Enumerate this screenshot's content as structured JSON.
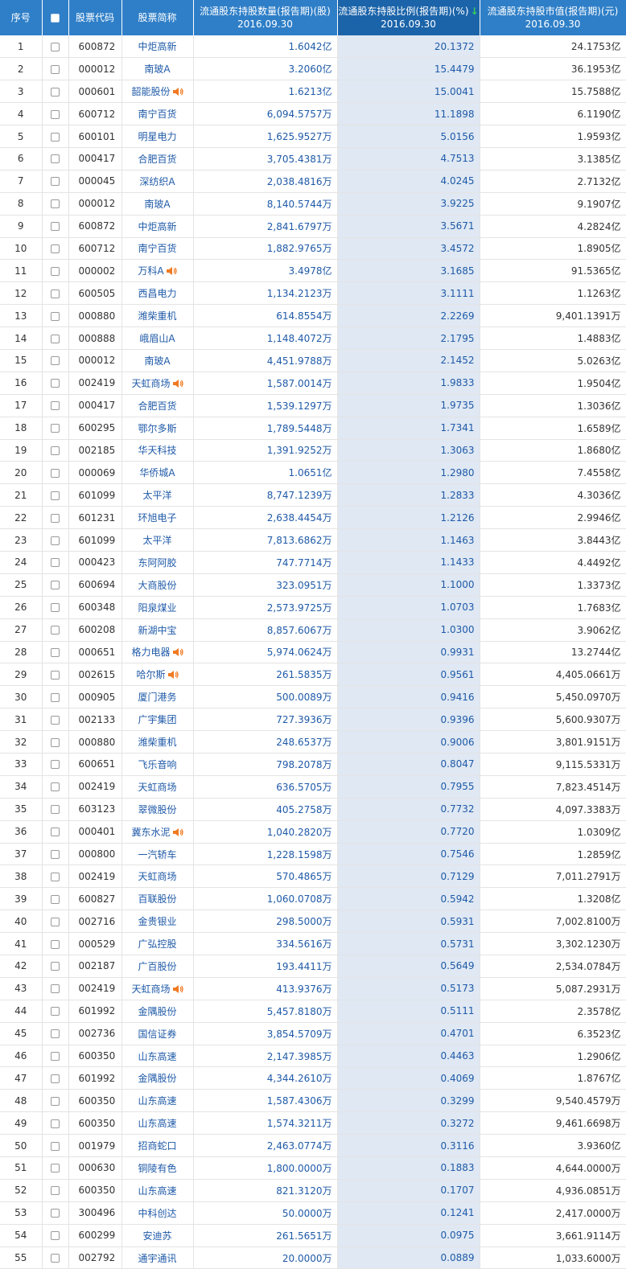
{
  "header": {
    "seq": "序号",
    "code": "股票代码",
    "name": "股票简称",
    "qty": "流通股东持股数量(报告期)(股)",
    "ratio": "流通股东持股比例(报告期)(%)",
    "ratio_arrow": "↓",
    "value": "流通股东持股市值(报告期)(元)",
    "period": "2016.09.30"
  },
  "colors": {
    "header_bg": "#2f7fc8",
    "sorted_col_bg": "#dfe8f3",
    "link": "#1f5aa8",
    "speaker": "#f07a22"
  },
  "rows": [
    {
      "seq": "1",
      "code": "600872",
      "name": "中炬高新",
      "qty": "1.6042亿",
      "ratio": "20.1372",
      "value": "24.1753亿",
      "speaker": false
    },
    {
      "seq": "2",
      "code": "000012",
      "name": "南玻A",
      "qty": "3.2060亿",
      "ratio": "15.4479",
      "value": "36.1953亿",
      "speaker": false
    },
    {
      "seq": "3",
      "code": "000601",
      "name": "韶能股份",
      "qty": "1.6213亿",
      "ratio": "15.0041",
      "value": "15.7588亿",
      "speaker": true
    },
    {
      "seq": "4",
      "code": "600712",
      "name": "南宁百货",
      "qty": "6,094.5757万",
      "ratio": "11.1898",
      "value": "6.1190亿",
      "speaker": false
    },
    {
      "seq": "5",
      "code": "600101",
      "name": "明星电力",
      "qty": "1,625.9527万",
      "ratio": "5.0156",
      "value": "1.9593亿",
      "speaker": false
    },
    {
      "seq": "6",
      "code": "000417",
      "name": "合肥百货",
      "qty": "3,705.4381万",
      "ratio": "4.7513",
      "value": "3.1385亿",
      "speaker": false
    },
    {
      "seq": "7",
      "code": "000045",
      "name": "深纺织A",
      "qty": "2,038.4816万",
      "ratio": "4.0245",
      "value": "2.7132亿",
      "speaker": false
    },
    {
      "seq": "8",
      "code": "000012",
      "name": "南玻A",
      "qty": "8,140.5744万",
      "ratio": "3.9225",
      "value": "9.1907亿",
      "speaker": false
    },
    {
      "seq": "9",
      "code": "600872",
      "name": "中炬高新",
      "qty": "2,841.6797万",
      "ratio": "3.5671",
      "value": "4.2824亿",
      "speaker": false
    },
    {
      "seq": "10",
      "code": "600712",
      "name": "南宁百货",
      "qty": "1,882.9765万",
      "ratio": "3.4572",
      "value": "1.8905亿",
      "speaker": false
    },
    {
      "seq": "11",
      "code": "000002",
      "name": "万科A",
      "qty": "3.4978亿",
      "ratio": "3.1685",
      "value": "91.5365亿",
      "speaker": true
    },
    {
      "seq": "12",
      "code": "600505",
      "name": "西昌电力",
      "qty": "1,134.2123万",
      "ratio": "3.1111",
      "value": "1.1263亿",
      "speaker": false
    },
    {
      "seq": "13",
      "code": "000880",
      "name": "潍柴重机",
      "qty": "614.8554万",
      "ratio": "2.2269",
      "value": "9,401.1391万",
      "speaker": false
    },
    {
      "seq": "14",
      "code": "000888",
      "name": "峨眉山A",
      "qty": "1,148.4072万",
      "ratio": "2.1795",
      "value": "1.4883亿",
      "speaker": false
    },
    {
      "seq": "15",
      "code": "000012",
      "name": "南玻A",
      "qty": "4,451.9788万",
      "ratio": "2.1452",
      "value": "5.0263亿",
      "speaker": false
    },
    {
      "seq": "16",
      "code": "002419",
      "name": "天虹商场",
      "qty": "1,587.0014万",
      "ratio": "1.9833",
      "value": "1.9504亿",
      "speaker": true
    },
    {
      "seq": "17",
      "code": "000417",
      "name": "合肥百货",
      "qty": "1,539.1297万",
      "ratio": "1.9735",
      "value": "1.3036亿",
      "speaker": false
    },
    {
      "seq": "18",
      "code": "600295",
      "name": "鄂尔多斯",
      "qty": "1,789.5448万",
      "ratio": "1.7341",
      "value": "1.6589亿",
      "speaker": false
    },
    {
      "seq": "19",
      "code": "002185",
      "name": "华天科技",
      "qty": "1,391.9252万",
      "ratio": "1.3063",
      "value": "1.8680亿",
      "speaker": false
    },
    {
      "seq": "20",
      "code": "000069",
      "name": "华侨城A",
      "qty": "1.0651亿",
      "ratio": "1.2980",
      "value": "7.4558亿",
      "speaker": false
    },
    {
      "seq": "21",
      "code": "601099",
      "name": "太平洋",
      "qty": "8,747.1239万",
      "ratio": "1.2833",
      "value": "4.3036亿",
      "speaker": false
    },
    {
      "seq": "22",
      "code": "601231",
      "name": "环旭电子",
      "qty": "2,638.4454万",
      "ratio": "1.2126",
      "value": "2.9946亿",
      "speaker": false
    },
    {
      "seq": "23",
      "code": "601099",
      "name": "太平洋",
      "qty": "7,813.6862万",
      "ratio": "1.1463",
      "value": "3.8443亿",
      "speaker": false
    },
    {
      "seq": "24",
      "code": "000423",
      "name": "东阿阿胶",
      "qty": "747.7714万",
      "ratio": "1.1433",
      "value": "4.4492亿",
      "speaker": false
    },
    {
      "seq": "25",
      "code": "600694",
      "name": "大商股份",
      "qty": "323.0951万",
      "ratio": "1.1000",
      "value": "1.3373亿",
      "speaker": false
    },
    {
      "seq": "26",
      "code": "600348",
      "name": "阳泉煤业",
      "qty": "2,573.9725万",
      "ratio": "1.0703",
      "value": "1.7683亿",
      "speaker": false
    },
    {
      "seq": "27",
      "code": "600208",
      "name": "新湖中宝",
      "qty": "8,857.6067万",
      "ratio": "1.0300",
      "value": "3.9062亿",
      "speaker": false
    },
    {
      "seq": "28",
      "code": "000651",
      "name": "格力电器",
      "qty": "5,974.0624万",
      "ratio": "0.9931",
      "value": "13.2744亿",
      "speaker": true
    },
    {
      "seq": "29",
      "code": "002615",
      "name": "哈尔斯",
      "qty": "261.5835万",
      "ratio": "0.9561",
      "value": "4,405.0661万",
      "speaker": true
    },
    {
      "seq": "30",
      "code": "000905",
      "name": "厦门港务",
      "qty": "500.0089万",
      "ratio": "0.9416",
      "value": "5,450.0970万",
      "speaker": false
    },
    {
      "seq": "31",
      "code": "002133",
      "name": "广宇集团",
      "qty": "727.3936万",
      "ratio": "0.9396",
      "value": "5,600.9307万",
      "speaker": false
    },
    {
      "seq": "32",
      "code": "000880",
      "name": "潍柴重机",
      "qty": "248.6537万",
      "ratio": "0.9006",
      "value": "3,801.9151万",
      "speaker": false
    },
    {
      "seq": "33",
      "code": "600651",
      "name": "飞乐音响",
      "qty": "798.2078万",
      "ratio": "0.8047",
      "value": "9,115.5331万",
      "speaker": false
    },
    {
      "seq": "34",
      "code": "002419",
      "name": "天虹商场",
      "qty": "636.5705万",
      "ratio": "0.7955",
      "value": "7,823.4514万",
      "speaker": false
    },
    {
      "seq": "35",
      "code": "603123",
      "name": "翠微股份",
      "qty": "405.2758万",
      "ratio": "0.7732",
      "value": "4,097.3383万",
      "speaker": false
    },
    {
      "seq": "36",
      "code": "000401",
      "name": "冀东水泥",
      "qty": "1,040.2820万",
      "ratio": "0.7720",
      "value": "1.0309亿",
      "speaker": true
    },
    {
      "seq": "37",
      "code": "000800",
      "name": "一汽轿车",
      "qty": "1,228.1598万",
      "ratio": "0.7546",
      "value": "1.2859亿",
      "speaker": false
    },
    {
      "seq": "38",
      "code": "002419",
      "name": "天虹商场",
      "qty": "570.4865万",
      "ratio": "0.7129",
      "value": "7,011.2791万",
      "speaker": false
    },
    {
      "seq": "39",
      "code": "600827",
      "name": "百联股份",
      "qty": "1,060.0708万",
      "ratio": "0.5942",
      "value": "1.3208亿",
      "speaker": false
    },
    {
      "seq": "40",
      "code": "002716",
      "name": "金贵银业",
      "qty": "298.5000万",
      "ratio": "0.5931",
      "value": "7,002.8100万",
      "speaker": false
    },
    {
      "seq": "41",
      "code": "000529",
      "name": "广弘控股",
      "qty": "334.5616万",
      "ratio": "0.5731",
      "value": "3,302.1230万",
      "speaker": false
    },
    {
      "seq": "42",
      "code": "002187",
      "name": "广百股份",
      "qty": "193.4411万",
      "ratio": "0.5649",
      "value": "2,534.0784万",
      "speaker": false
    },
    {
      "seq": "43",
      "code": "002419",
      "name": "天虹商场",
      "qty": "413.9376万",
      "ratio": "0.5173",
      "value": "5,087.2931万",
      "speaker": true
    },
    {
      "seq": "44",
      "code": "601992",
      "name": "金隅股份",
      "qty": "5,457.8180万",
      "ratio": "0.5111",
      "value": "2.3578亿",
      "speaker": false
    },
    {
      "seq": "45",
      "code": "002736",
      "name": "国信证券",
      "qty": "3,854.5709万",
      "ratio": "0.4701",
      "value": "6.3523亿",
      "speaker": false
    },
    {
      "seq": "46",
      "code": "600350",
      "name": "山东高速",
      "qty": "2,147.3985万",
      "ratio": "0.4463",
      "value": "1.2906亿",
      "speaker": false
    },
    {
      "seq": "47",
      "code": "601992",
      "name": "金隅股份",
      "qty": "4,344.2610万",
      "ratio": "0.4069",
      "value": "1.8767亿",
      "speaker": false
    },
    {
      "seq": "48",
      "code": "600350",
      "name": "山东高速",
      "qty": "1,587.4306万",
      "ratio": "0.3299",
      "value": "9,540.4579万",
      "speaker": false
    },
    {
      "seq": "49",
      "code": "600350",
      "name": "山东高速",
      "qty": "1,574.3211万",
      "ratio": "0.3272",
      "value": "9,461.6698万",
      "speaker": false
    },
    {
      "seq": "50",
      "code": "001979",
      "name": "招商蛇口",
      "qty": "2,463.0774万",
      "ratio": "0.3116",
      "value": "3.9360亿",
      "speaker": false
    },
    {
      "seq": "51",
      "code": "000630",
      "name": "铜陵有色",
      "qty": "1,800.0000万",
      "ratio": "0.1883",
      "value": "4,644.0000万",
      "speaker": false
    },
    {
      "seq": "52",
      "code": "600350",
      "name": "山东高速",
      "qty": "821.3120万",
      "ratio": "0.1707",
      "value": "4,936.0851万",
      "speaker": false
    },
    {
      "seq": "53",
      "code": "300496",
      "name": "中科创达",
      "qty": "50.0000万",
      "ratio": "0.1241",
      "value": "2,417.0000万",
      "speaker": false
    },
    {
      "seq": "54",
      "code": "600299",
      "name": "安迪苏",
      "qty": "261.5651万",
      "ratio": "0.0975",
      "value": "3,661.9114万",
      "speaker": false
    },
    {
      "seq": "55",
      "code": "002792",
      "name": "通宇通讯",
      "qty": "20.0000万",
      "ratio": "0.0889",
      "value": "1,033.6000万",
      "speaker": false
    }
  ]
}
